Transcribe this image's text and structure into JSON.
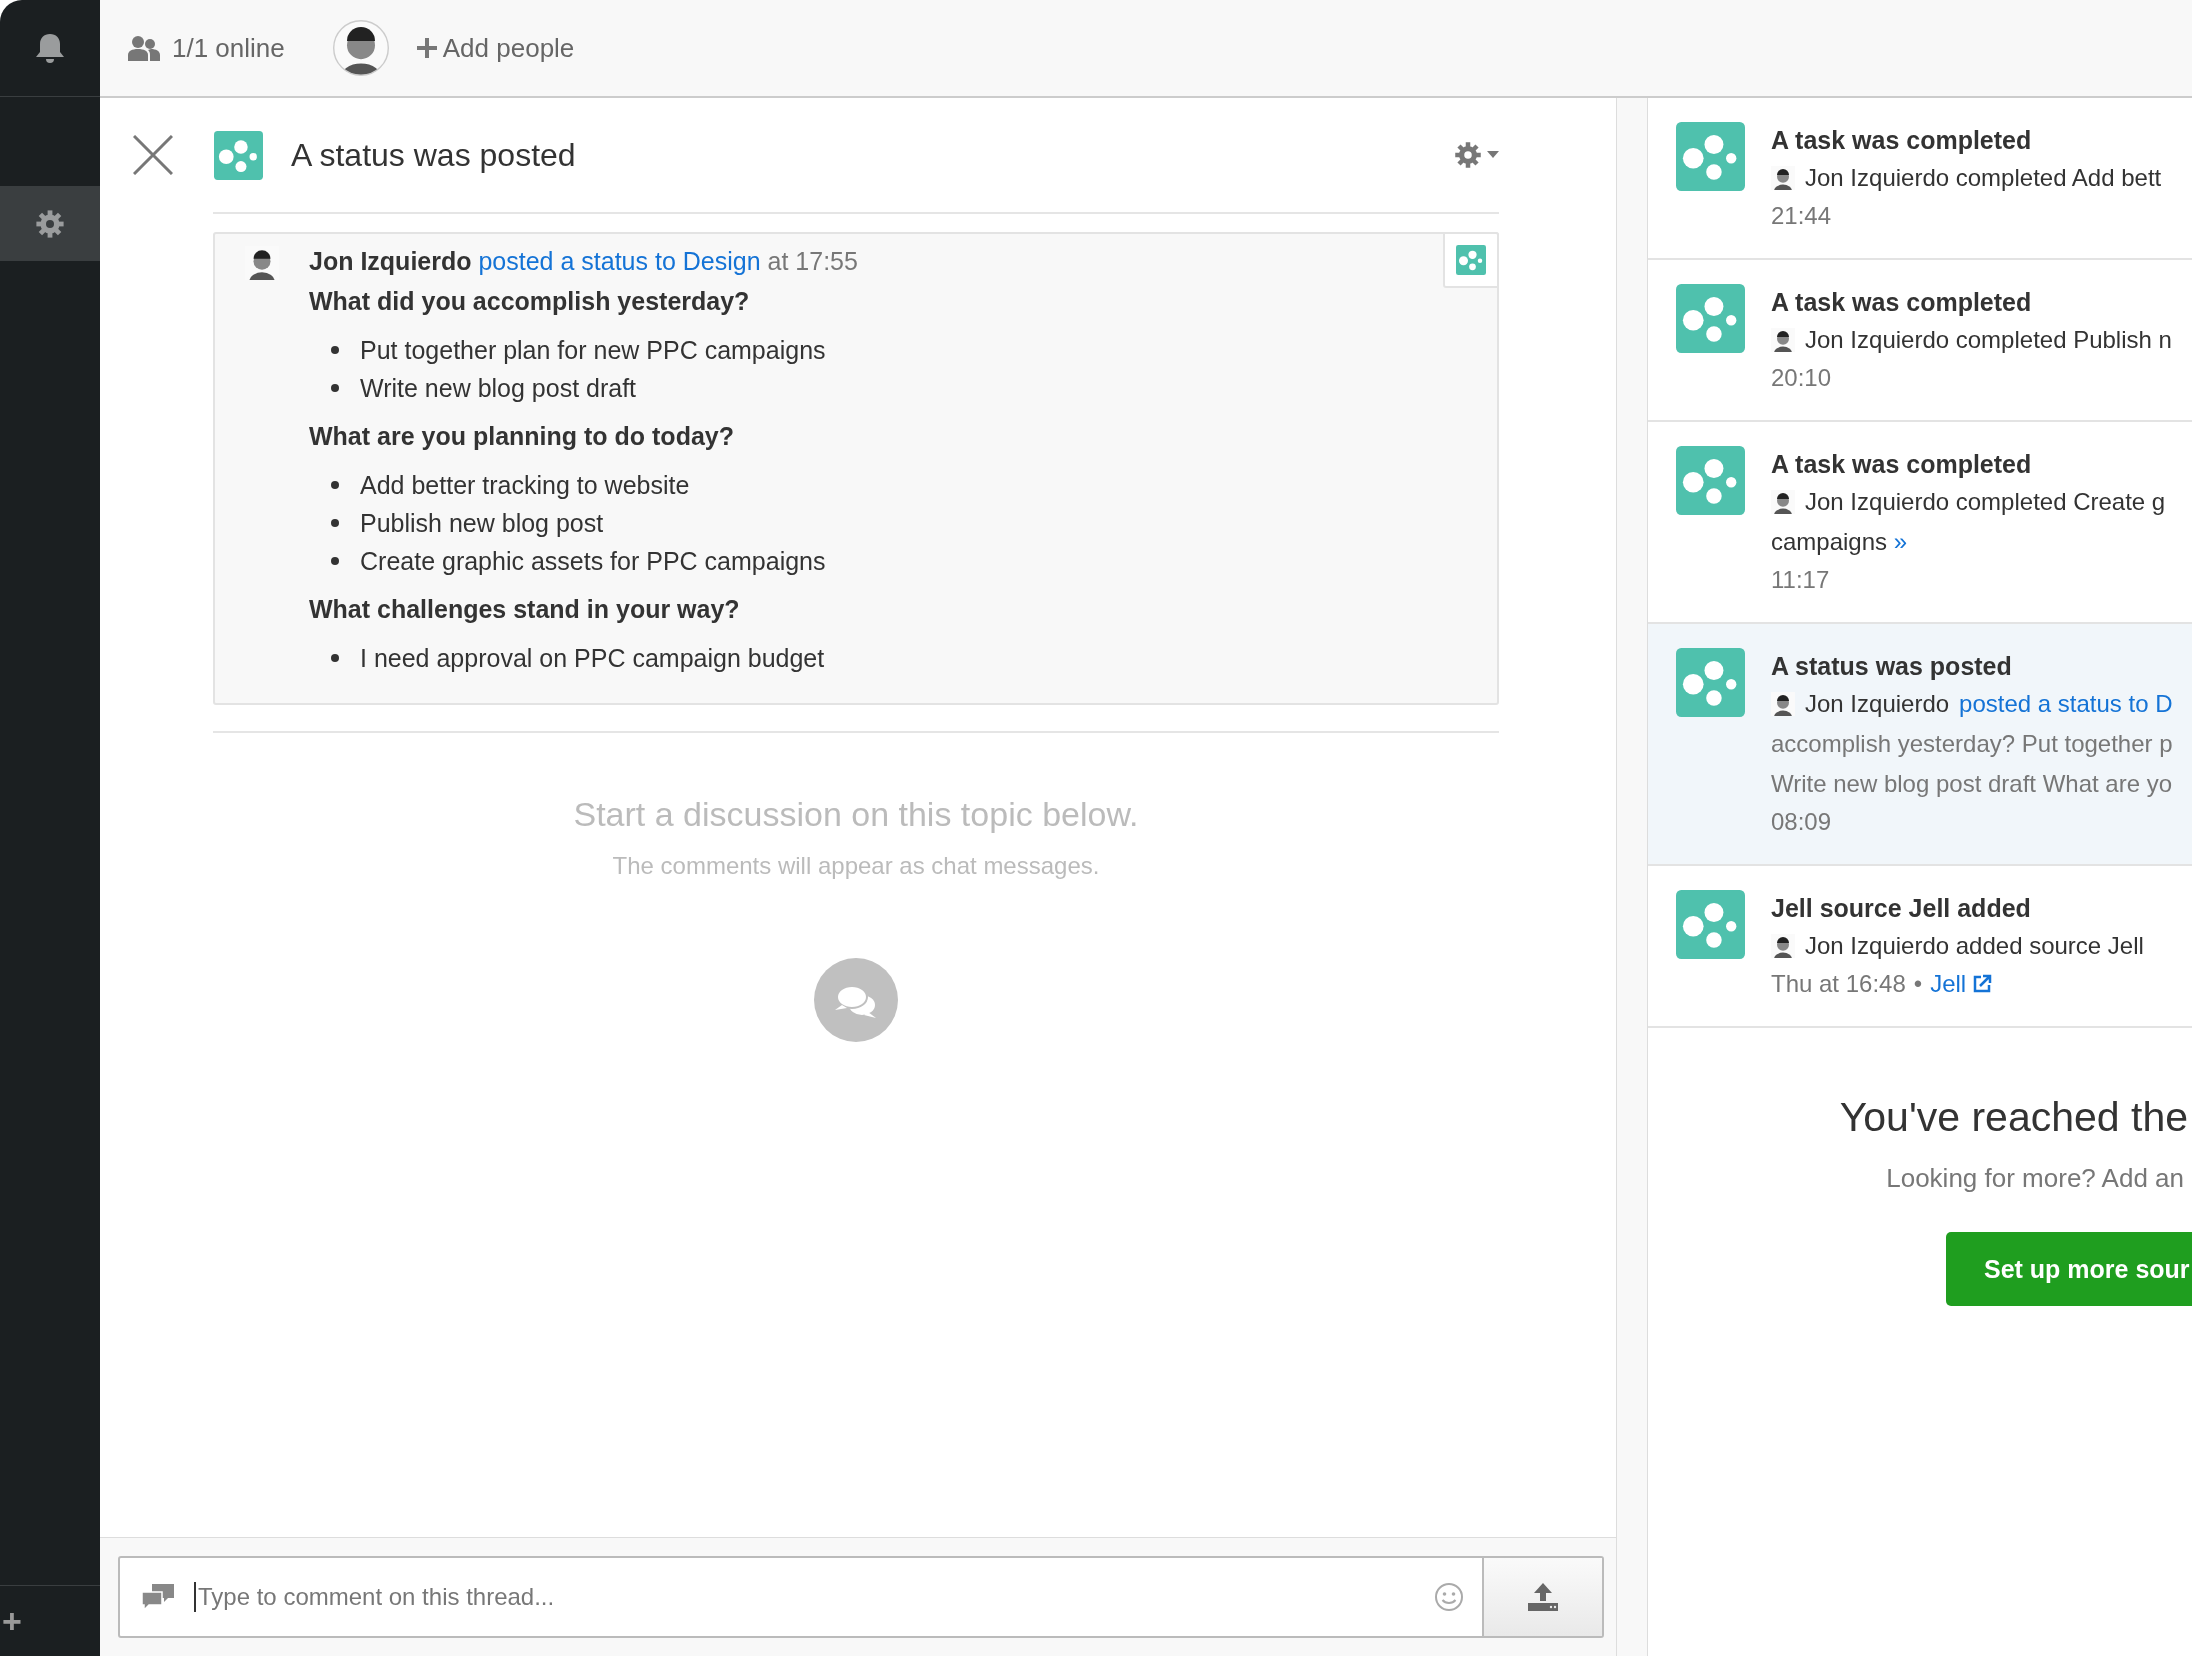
{
  "sidebar": {
    "items": [
      {
        "kind": "bell",
        "selected": false
      },
      {
        "kind": "settings",
        "selected": true
      }
    ],
    "add_button": "+"
  },
  "top_bar": {
    "online": "1/1 online",
    "add_people": "Add people"
  },
  "detail": {
    "title": "A status was posted",
    "post": {
      "author": "Jon Izquierdo",
      "action": "posted a status to Design",
      "time": "at 17:55",
      "sections": [
        {
          "question": "What did you accomplish yesterday?",
          "answers": [
            "Put together plan for new PPC campaigns",
            "Write new blog post draft"
          ]
        },
        {
          "question": "What are you planning to do today?",
          "answers": [
            "Add better tracking to website",
            "Publish new blog post",
            "Create graphic assets for PPC campaigns"
          ]
        },
        {
          "question": "What challenges stand in your way?",
          "answers": [
            "I need approval on PPC campaign budget"
          ]
        }
      ]
    },
    "empty": {
      "heading": "Start a discussion on this topic below.",
      "note": "The comments will appear as chat messages."
    }
  },
  "comment_box": {
    "placeholder": "Type to comment on this thread..."
  },
  "feed": {
    "items": [
      {
        "title": "A task was completed",
        "text": "Jon Izquierdo completed Add bett",
        "time": "21:44",
        "selected": false
      },
      {
        "title": "A task was completed",
        "text": "Jon Izquierdo completed Publish n",
        "time": "20:10",
        "selected": false
      },
      {
        "title": "A task was completed",
        "text": "Jon Izquierdo completed Create g",
        "continuation": [
          "campaigns"
        ],
        "more": "»",
        "time": "11:17",
        "selected": false
      },
      {
        "title": "A status was posted",
        "text": "Jon Izquierdo",
        "link": "posted a status to D",
        "continuation": [
          "accomplish yesterday? Put together p",
          "Write new blog post draft What are yo"
        ],
        "time": "08:09",
        "selected": true
      },
      {
        "title": "Jell source Jell added",
        "text": "Jon Izquierdo added source Jell",
        "time": "Thu at 16:48",
        "separator": "•",
        "source": "Jell",
        "selected": false
      }
    ],
    "end": {
      "heading": "You've reached the",
      "note": "Looking for more? Add an",
      "button": "Set up more sour"
    }
  }
}
